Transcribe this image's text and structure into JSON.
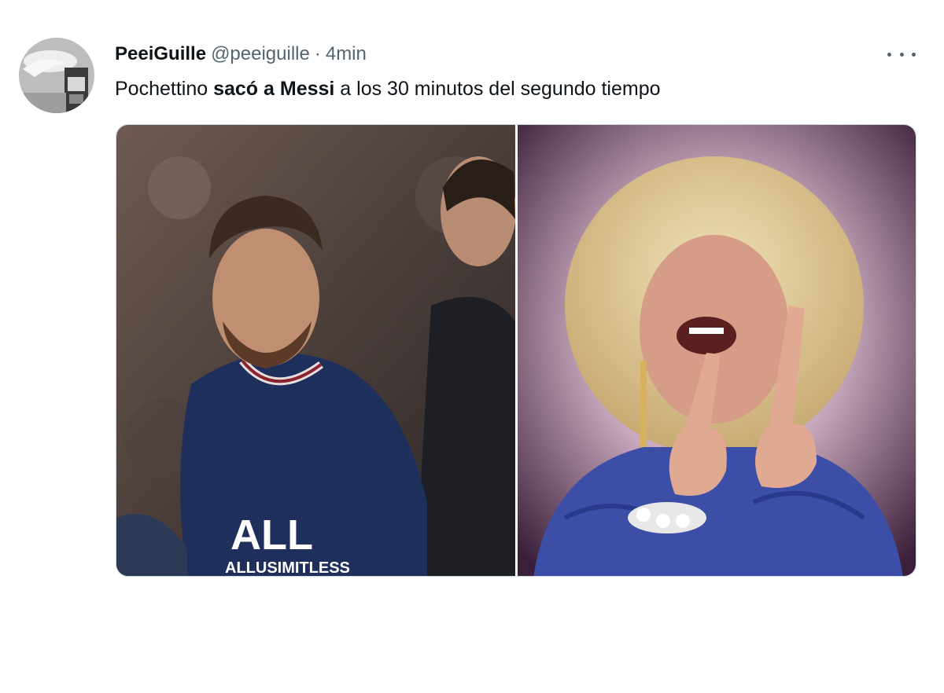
{
  "tweet": {
    "display_name": "PeeiGuille",
    "handle": "@peeiguille",
    "separator": "·",
    "time": "4min",
    "text_parts": [
      "Pochettino ",
      "sacó a Messi",
      " a los 30 minutos del segundo tiempo"
    ],
    "more_icon": "more-horizontal-icon"
  },
  "media": {
    "left_image_caption": "ALL",
    "left_image_sub": "ALLUSIMITLESS"
  },
  "colors": {
    "secondary_text": "#536471",
    "primary_text": "#0f1419",
    "border": "#cfd9de"
  }
}
